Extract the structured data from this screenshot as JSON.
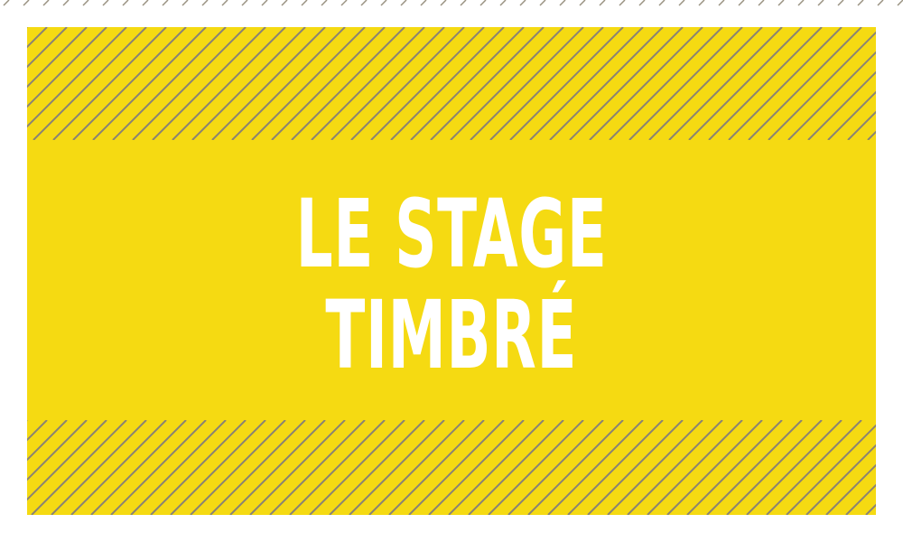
{
  "title": {
    "line1": "LE STAGE",
    "line2": "TIMBRÉ"
  },
  "colors": {
    "background": "#f5da12",
    "stripe": "#8a8373",
    "text": "#ffffff"
  }
}
